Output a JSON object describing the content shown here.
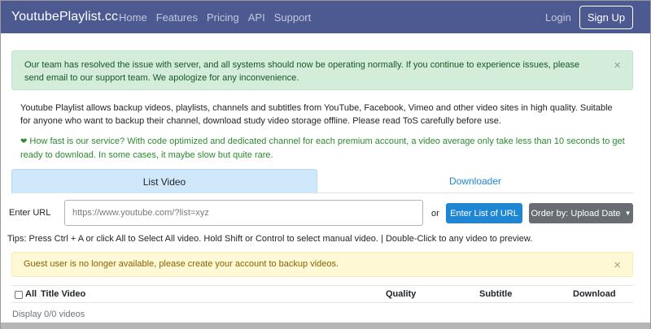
{
  "navbar": {
    "brand": "YoutubePlaylist.cc",
    "links": [
      "Home",
      "Features",
      "Pricing",
      "API",
      "Support"
    ],
    "login": "Login",
    "signup": "Sign Up"
  },
  "alerts": {
    "success": "Our team has resolved the issue with server, and all systems should now be operating normally. If you continue to experience issues, please send email to our support team. We apologize for any inconvenience.",
    "close_symbol": "×",
    "warning": "Guest user is no longer available, please create your account to backup videos."
  },
  "intro": "Youtube Playlist allows backup videos, playlists, channels and subtitles from YouTube, Facebook, Vimeo and other video sites in high quality. Suitable for anyone who want to backup their channel, download study video storage offline. Please read ToS carefully before use.",
  "speed_note": "How fast is our service? With code optimized and dedicated channel for each premium account, a video average only take less than 10 seconds to get ready to download. In some cases, it maybe slow but quite rare.",
  "tabs": {
    "list_video": "List Video",
    "downloader": "Downloader"
  },
  "url_row": {
    "label": "Enter URL",
    "placeholder": "https://www.youtube.com/?list=xyz",
    "or": "or",
    "enter_list_button": "Enter List of URL",
    "order_button": "Order by: Upload Date"
  },
  "tips": "Tips: Press Ctrl + A or click All to Select All video. Hold Shift or Control to select manual video. | Double-Click to any video to preview.",
  "table": {
    "all": "All",
    "title": "Title Video",
    "quality": "Quality",
    "subtitle": "Subtitle",
    "download": "Download"
  },
  "display_count": "Display 0/0 videos",
  "colors": {
    "navbar": "#4c5a91",
    "primary": "#1f86d4",
    "success_bg": "#d4edda",
    "warning_bg": "#fff8d5",
    "speed_text": "#2b8a2e"
  }
}
